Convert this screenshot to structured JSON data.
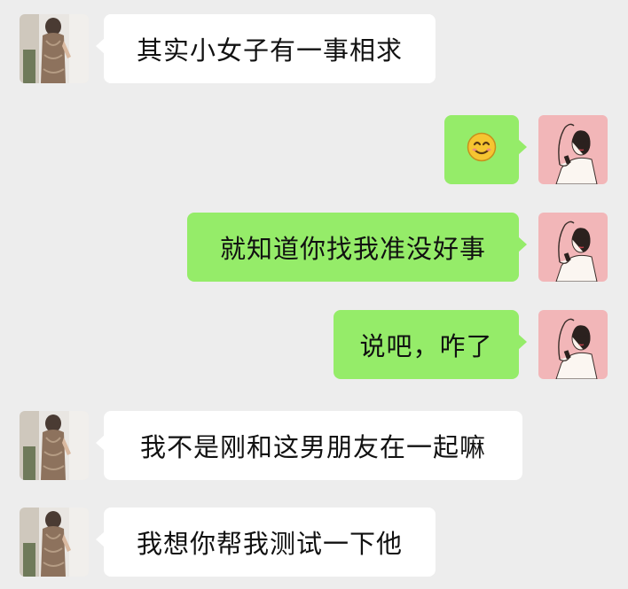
{
  "chat": {
    "messages": [
      {
        "sender": "contact",
        "text": "其实小女子有一事相求"
      },
      {
        "sender": "me",
        "text": "",
        "emoji": "smiling-face"
      },
      {
        "sender": "me",
        "text": "就知道你找我准没好事"
      },
      {
        "sender": "me",
        "text": "说吧，咋了"
      },
      {
        "sender": "contact",
        "text": "我不是刚和这男朋友在一起嘛"
      },
      {
        "sender": "contact",
        "text": "我想你帮我测试一下他"
      }
    ]
  },
  "colors": {
    "background": "#ededed",
    "incoming_bubble": "#ffffff",
    "outgoing_bubble": "#95ec69",
    "my_avatar_bg": "#f2b6b8"
  }
}
